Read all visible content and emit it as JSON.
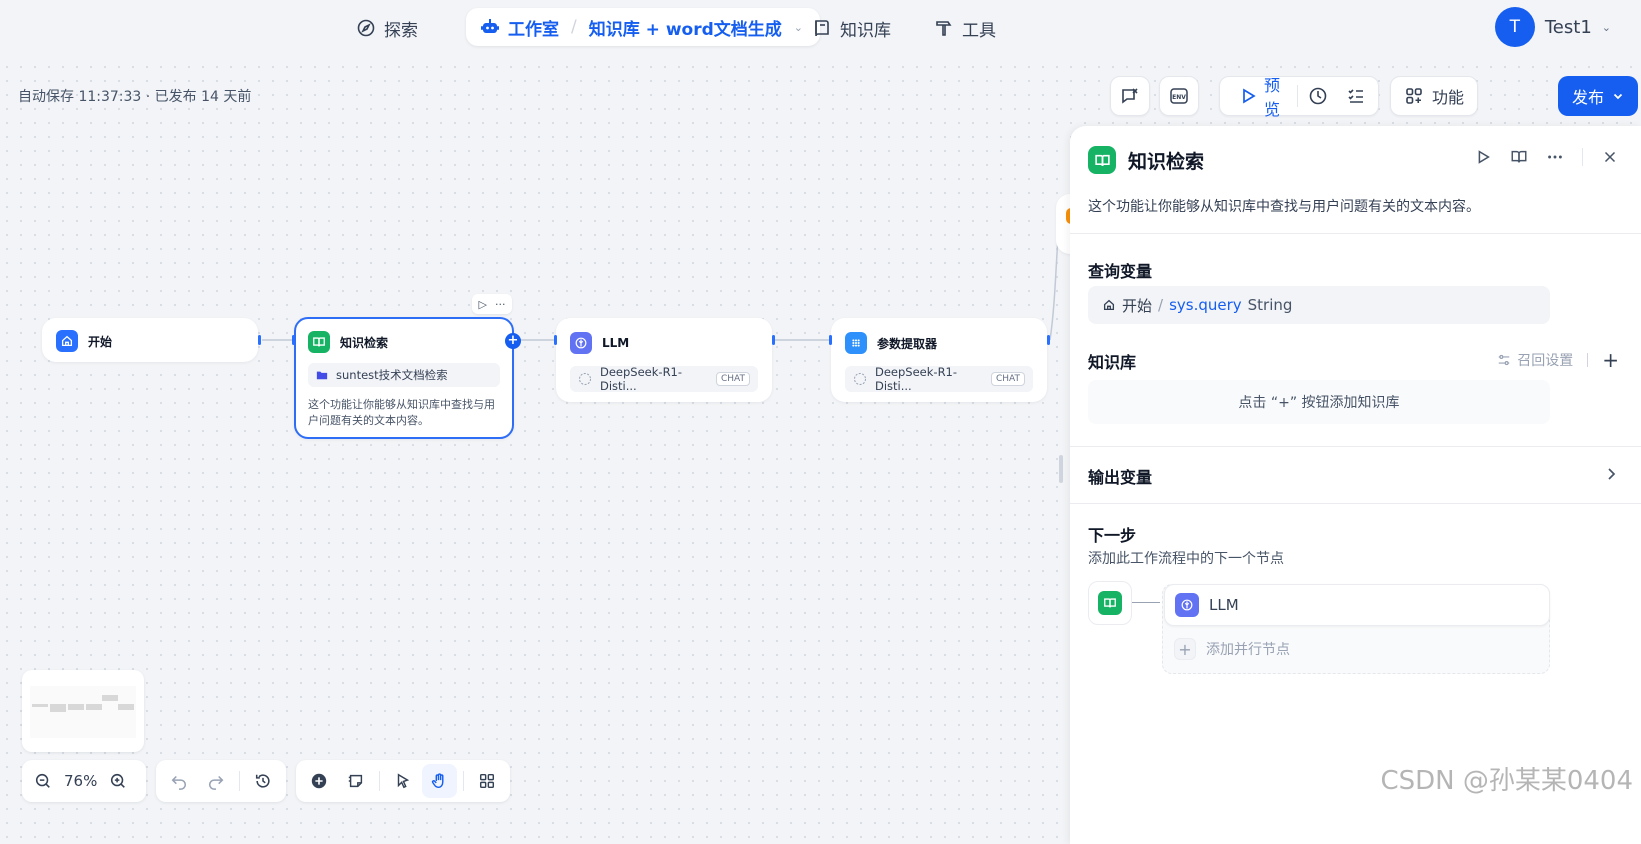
{
  "nav": {
    "explore": "探索",
    "studio": "工作室",
    "app_name": "知识库 + word文档生成",
    "knowledge": "知识库",
    "tools": "工具"
  },
  "user": {
    "initial": "T",
    "name": "Test1"
  },
  "status": {
    "autosave": "自动保存 11:37:33 · 已发布 14 天前"
  },
  "toolbar": {
    "env_label": "ENV",
    "preview": "预览",
    "features": "功能",
    "publish": "发布"
  },
  "nodes": {
    "start": {
      "title": "开始"
    },
    "knowledge": {
      "title": "知识检索",
      "dataset": "suntest技术文档检索",
      "desc": "这个功能让你能够从知识库中查找与用户问题有关的文本内容。"
    },
    "llm": {
      "title": "LLM",
      "model": "DeepSeek-R1-Disti...",
      "mode": "CHAT"
    },
    "param": {
      "title": "参数提取器",
      "model": "DeepSeek-R1-Disti...",
      "mode": "CHAT"
    }
  },
  "zoom": {
    "level": "76%"
  },
  "panel": {
    "title": "知识检索",
    "desc": "这个功能让你能够从知识库中查找与用户问题有关的文本内容。",
    "query_title": "查询变量",
    "query_node": "开始",
    "query_var": "sys.query",
    "query_type": "String",
    "kb_title": "知识库",
    "recall_settings": "召回设置",
    "kb_empty": "点击 “+” 按钮添加知识库",
    "output_title": "输出变量",
    "next_title": "下一步",
    "next_desc": "添加此工作流程中的下一个节点",
    "next_node": "LLM",
    "add_parallel": "添加并行节点"
  },
  "watermark": "CSDN @孙某某0404",
  "colors": {
    "accent": "#155eef",
    "knowledge_green": "#16b364",
    "llm_indigo": "#6172f3"
  }
}
